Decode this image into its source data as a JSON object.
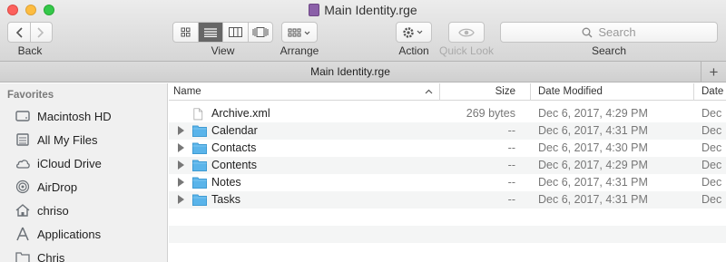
{
  "window": {
    "title": "Main Identity.rge"
  },
  "toolbar": {
    "back_label": "Back",
    "view_label": "View",
    "arrange_label": "Arrange",
    "action_label": "Action",
    "quicklook_label": "Quick Look",
    "search_label": "Search",
    "search_placeholder": "Search"
  },
  "pathbar": {
    "title": "Main Identity.rge"
  },
  "sidebar": {
    "heading": "Favorites",
    "items": [
      {
        "label": "Macintosh HD",
        "icon": "hard-drive-icon"
      },
      {
        "label": "All My Files",
        "icon": "all-files-icon"
      },
      {
        "label": "iCloud Drive",
        "icon": "cloud-icon"
      },
      {
        "label": "AirDrop",
        "icon": "airdrop-icon"
      },
      {
        "label": "chriso",
        "icon": "home-icon"
      },
      {
        "label": "Applications",
        "icon": "applications-icon"
      },
      {
        "label": "Chris",
        "icon": "folder-icon"
      }
    ]
  },
  "columns": {
    "name": "Name",
    "size": "Size",
    "date_modified": "Date Modified",
    "date_extra": "Date"
  },
  "files": [
    {
      "name": "Archive.xml",
      "kind": "file",
      "size": "269 bytes",
      "date": "Dec 6, 2017, 4:29 PM",
      "date_extra": "Dec"
    },
    {
      "name": "Calendar",
      "kind": "folder",
      "size": "--",
      "date": "Dec 6, 2017, 4:31 PM",
      "date_extra": "Dec"
    },
    {
      "name": "Contacts",
      "kind": "folder",
      "size": "--",
      "date": "Dec 6, 2017, 4:30 PM",
      "date_extra": "Dec"
    },
    {
      "name": "Contents",
      "kind": "folder",
      "size": "--",
      "date": "Dec 6, 2017, 4:29 PM",
      "date_extra": "Dec"
    },
    {
      "name": "Notes",
      "kind": "folder",
      "size": "--",
      "date": "Dec 6, 2017, 4:31 PM",
      "date_extra": "Dec"
    },
    {
      "name": "Tasks",
      "kind": "folder",
      "size": "--",
      "date": "Dec 6, 2017, 4:31 PM",
      "date_extra": "Dec"
    }
  ],
  "colors": {
    "folder": "#5ab4ea",
    "accent": "#3b99fc"
  }
}
